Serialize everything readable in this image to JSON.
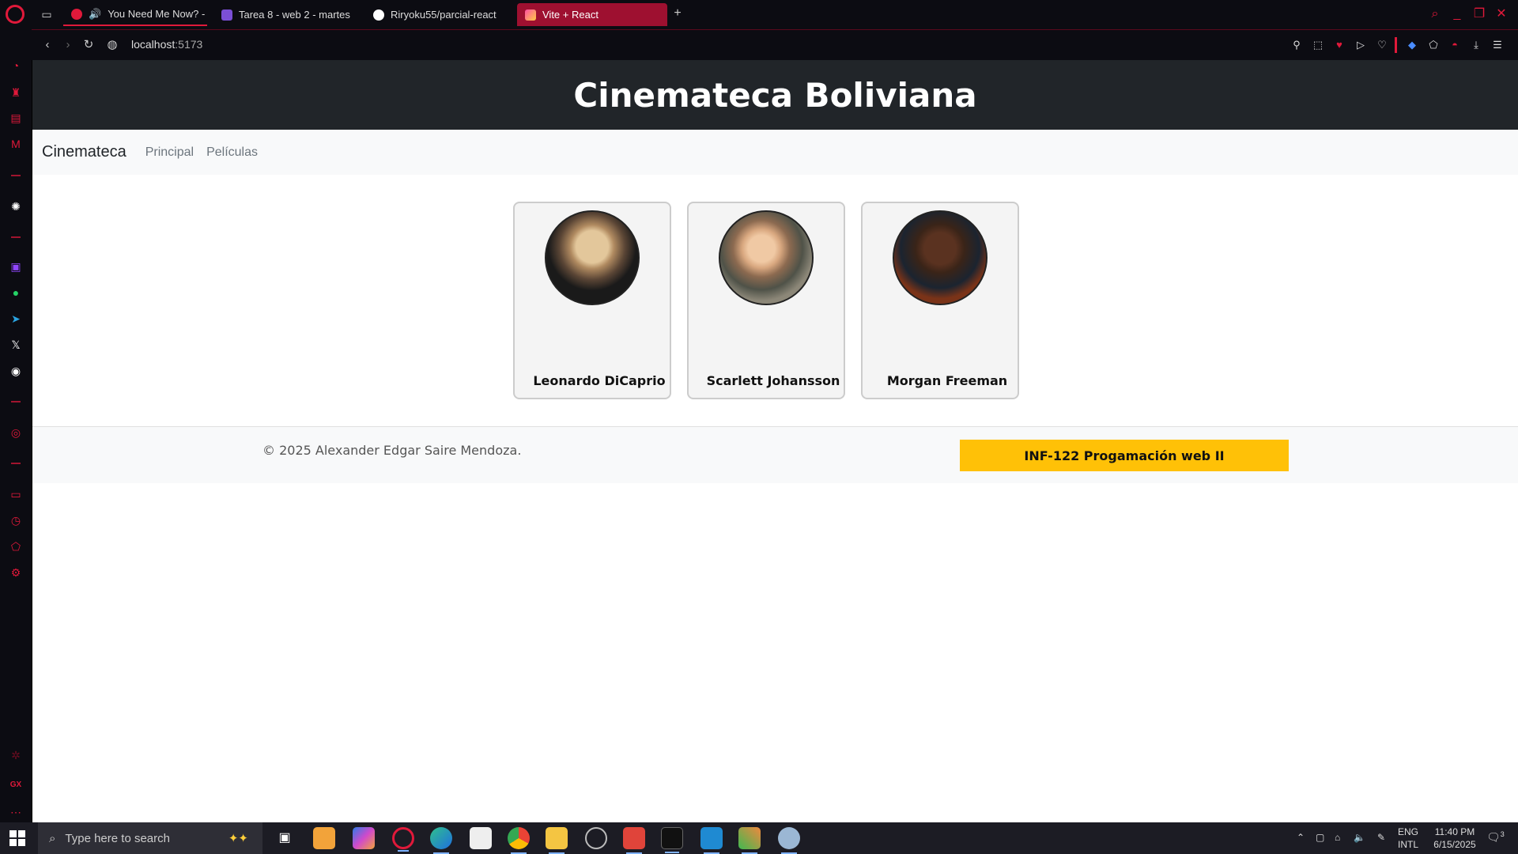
{
  "browser": {
    "tabs": [
      {
        "label": "You Need Me Now? -",
        "color": "#e0193a"
      },
      {
        "label": "Tarea 8 - web 2 - martes",
        "color": "#7b4fd6"
      },
      {
        "label": "Riryoku55/parcial-react",
        "color": "#ffffff"
      },
      {
        "label": "Vite + React",
        "color": "#ff4fa3"
      }
    ],
    "new_tab": "+",
    "url_host": "localhost",
    "url_port": ":5173"
  },
  "site": {
    "header_title": "Cinemateca Boliviana",
    "nav": {
      "brand": "Cinemateca",
      "links": [
        "Principal",
        "Películas"
      ]
    },
    "actors": [
      {
        "name": "Leonardo DiCaprio",
        "photo_colors": [
          "#1a1a1a",
          "#e3c79b",
          "#5a4535"
        ]
      },
      {
        "name": "Scarlett Johansson",
        "photo_colors": [
          "#8c8778",
          "#d8a77f",
          "#4f5248"
        ]
      },
      {
        "name": "Morgan Freeman",
        "photo_colors": [
          "#7a3318",
          "#3a2418",
          "#1b2430"
        ]
      }
    ],
    "footer": {
      "copyright": "© 2025 Alexander Edgar Saire Mendoza.",
      "course_button": "INF-122 Progamación web II"
    },
    "accent": "#ffc107"
  },
  "taskbar": {
    "search_placeholder": "Type here to search",
    "lang_line1": "ENG",
    "lang_line2": "INTL",
    "time": "11:40 PM",
    "date": "6/15/2025",
    "notifications": "3"
  }
}
